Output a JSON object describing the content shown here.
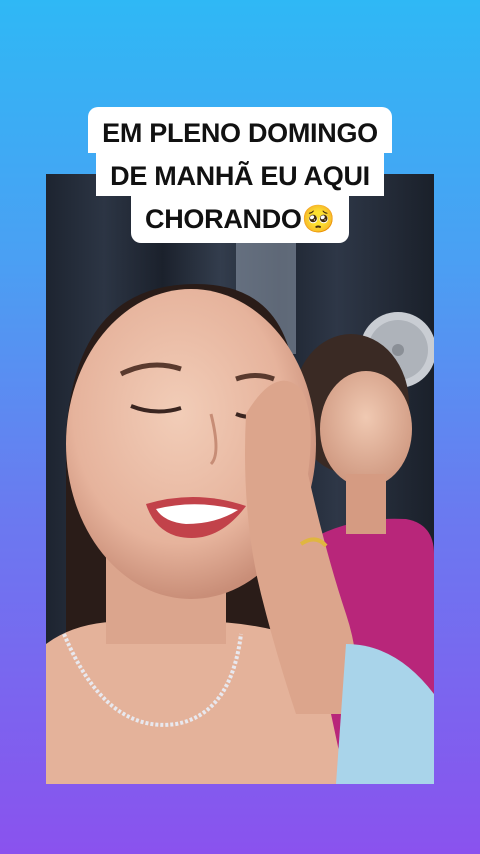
{
  "caption": {
    "line1": "EM PLENO DOMINGO",
    "line2": "DE MANHÃ EU AQUI",
    "line3": "CHORANDO🥺"
  },
  "colors": {
    "gradient_top": "#2fb8f5",
    "gradient_bottom": "#8a52ee",
    "caption_bg": "#ffffff",
    "caption_text": "#111111"
  }
}
